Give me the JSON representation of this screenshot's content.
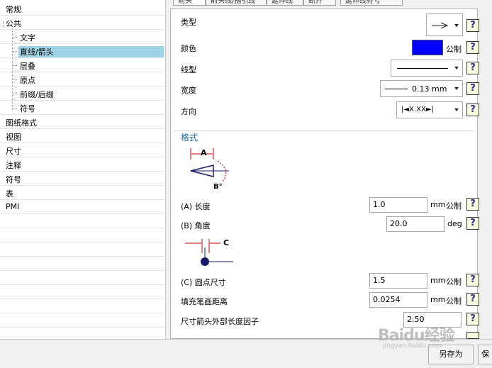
{
  "tree": {
    "items": [
      {
        "label": "常规",
        "level": 0
      },
      {
        "label": "公共",
        "level": 0
      },
      {
        "label": "文字",
        "level": 1
      },
      {
        "label": "直线/箭头",
        "level": 1,
        "selected": true
      },
      {
        "label": "层叠",
        "level": 1
      },
      {
        "label": "原点",
        "level": 1
      },
      {
        "label": "前缀/后缀",
        "level": 1
      },
      {
        "label": "符号",
        "level": 1
      },
      {
        "label": "图纸格式",
        "level": 0
      },
      {
        "label": "视图",
        "level": 0
      },
      {
        "label": "尺寸",
        "level": 0
      },
      {
        "label": "注释",
        "level": 0
      },
      {
        "label": "符号",
        "level": 0
      },
      {
        "label": "表",
        "level": 0
      },
      {
        "label": "PMI",
        "level": 0
      }
    ]
  },
  "tabs": [
    "箭头",
    "箭头线/指引线",
    "延伸线",
    "断开",
    "延伸线符号"
  ],
  "panel": {
    "type_label": "类型",
    "color_label": "颜色",
    "color_value": "#0000ff",
    "color_unit": "公制",
    "linetype_label": "线型",
    "width_label": "宽度",
    "width_value": "0.13 mm",
    "direction_label": "方向",
    "direction_value": "|◄X.XX►|",
    "format_title": "格式",
    "diagram_a": "A",
    "diagram_b": "B°",
    "diagram_c": "C",
    "length_label": "(A) 长度",
    "length_value": "1.0",
    "length_unit": "mm",
    "length_unit2": "公制",
    "angle_label": "(B) 角度",
    "angle_value": "20.0",
    "angle_unit": "deg",
    "dot_label": "(C) 圆点尺寸",
    "dot_value": "1.5",
    "dot_unit": "mm",
    "dot_unit2": "公制",
    "fill_label": "填充笔画距离",
    "fill_value": "0.0254",
    "fill_unit": "mm",
    "fill_unit2": "公制",
    "factor_label": "尺寸箭头外部长度因子",
    "factor_value": "2.50",
    "help_glyph": "?"
  },
  "buttons": {
    "save_as": "另存为",
    "save": "保"
  },
  "watermark": {
    "text": "Baidu经验",
    "sub": "jingyan.baidu.com"
  }
}
